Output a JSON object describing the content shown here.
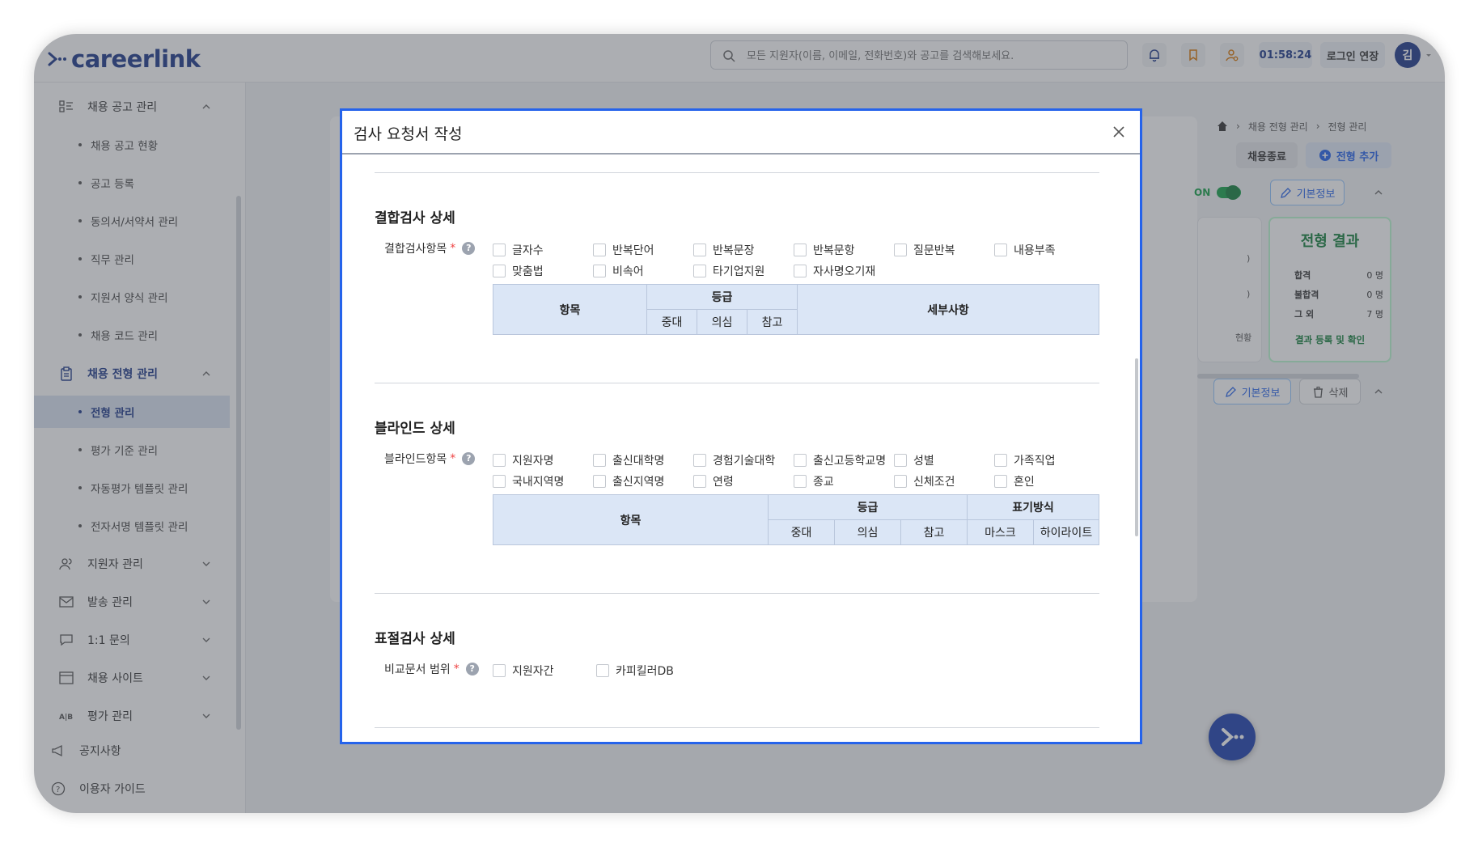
{
  "header": {
    "logo": "careerlink",
    "search_placeholder": "모든 지원자(이름, 이메일, 전화번호)와 공고를 검색해보세요.",
    "timer": "01:58:24",
    "extend_label": "로그인 연장",
    "avatar_initial": "김"
  },
  "sidebar": {
    "group_job": "채용 공고 관리",
    "job_items": [
      "채용 공고 현황",
      "공고 등록",
      "동의서/서약서 관리",
      "직무 관리",
      "지원서 양식 관리",
      "채용 코드 관리"
    ],
    "group_process": "채용 전형 관리",
    "process_items": [
      "전형 관리",
      "평가 기준 관리",
      "자동평가 템플릿 관리",
      "전자서명 템플릿 관리"
    ],
    "groups_rest": [
      "지원자 관리",
      "발송 관리",
      "1:1 문의",
      "채용 사이트",
      "평가 관리"
    ],
    "notice": "공지사항",
    "guide": "이용자 가이드"
  },
  "background": {
    "breadcrumb": [
      "채용 전형 관리",
      "전형 관리"
    ],
    "close_recruit": "채용종료",
    "add_stage": "전형 추가",
    "on_label": "ON",
    "basic_info": "기본정보",
    "delete": "삭제",
    "result_title": "전형 결과",
    "results": [
      {
        "label": "합격",
        "value": "0 명"
      },
      {
        "label": "불합격",
        "value": "0 명"
      },
      {
        "label": "그 외",
        "value": "7 명"
      }
    ],
    "result_link": "결과 등록 및 확인",
    "ghost_1": ")",
    "ghost_2": ")",
    "ghost_3": "현황"
  },
  "modal": {
    "title": "검사 요청서 작성",
    "combined": {
      "title": "결합검사 상세",
      "field_label": "결합검사항목",
      "options": [
        "글자수",
        "반복단어",
        "반복문장",
        "반복문항",
        "질문반복",
        "내용부족",
        "맞춤법",
        "비속어",
        "타기업지원",
        "자사명오기재"
      ],
      "table": {
        "item": "항목",
        "grade": "등급",
        "grades": [
          "중대",
          "의심",
          "참고"
        ],
        "detail": "세부사항"
      }
    },
    "blind": {
      "title": "블라인드 상세",
      "field_label": "블라인드항목",
      "options": [
        "지원자명",
        "출신대학명",
        "경험기술대학",
        "출신고등학교명",
        "성별",
        "가족직업",
        "국내지역명",
        "출신지역명",
        "연령",
        "종교",
        "신체조건",
        "혼인"
      ],
      "table": {
        "item": "항목",
        "grade": "등급",
        "grades": [
          "중대",
          "의심",
          "참고"
        ],
        "display": "표기방식",
        "displays": [
          "마스크",
          "하이라이트"
        ]
      }
    },
    "plagiarism": {
      "title": "표절검사 상세",
      "field_label": "비교문서 범위",
      "options": [
        "지원자간",
        "카피킬러DB"
      ]
    }
  },
  "colors": {
    "brand": "#1e3a8a",
    "accent": "#2563eb",
    "success": "#16a34a"
  }
}
